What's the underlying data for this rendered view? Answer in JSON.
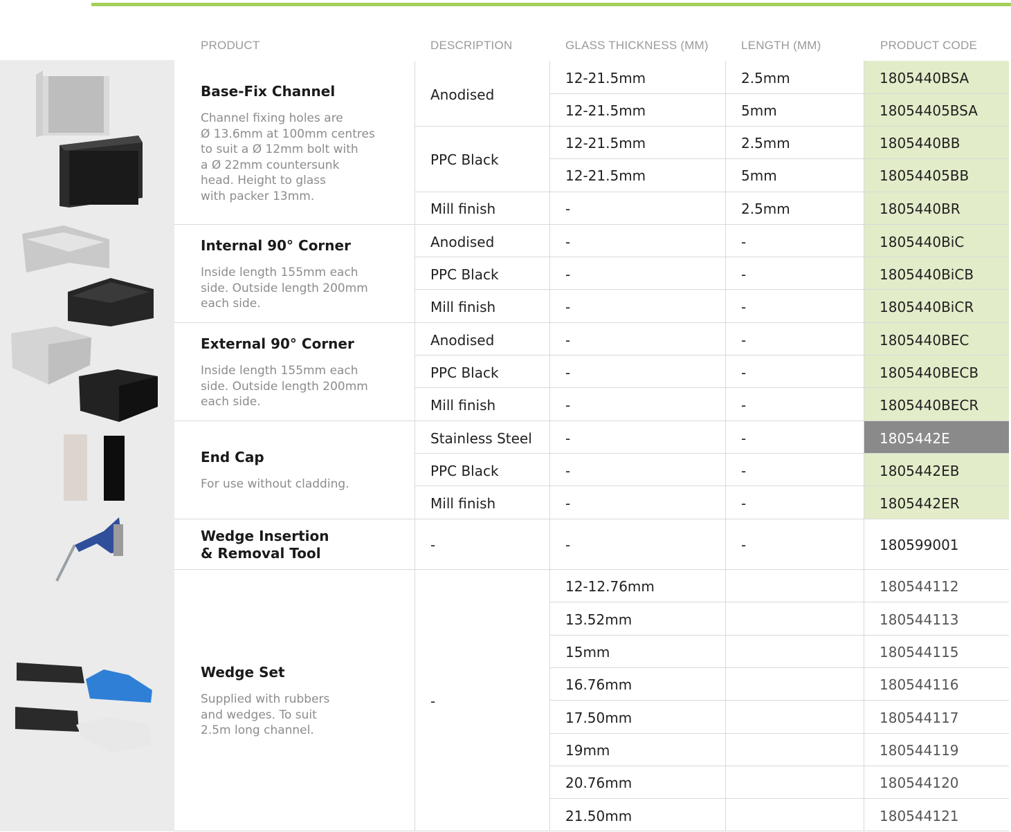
{
  "headers": {
    "product": "PRODUCT",
    "description": "DESCRIPTION",
    "glass": "GLASS THICKNESS (MM)",
    "length": "LENGTH (MM)",
    "code": "PRODUCT CODE"
  },
  "products": {
    "base": {
      "name": "Base-Fix Channel",
      "note": [
        "Channel fixing holes are",
        "Ø 13.6mm at 100mm centres",
        "to suit a Ø 12mm bolt with",
        "a Ø 22mm countersunk",
        "head. Height to glass",
        "with packer 13mm."
      ]
    },
    "internal": {
      "name": "Internal 90° Corner",
      "note": [
        "Inside length 155mm each",
        "side. Outside length 200mm",
        "each side."
      ]
    },
    "external": {
      "name": "External 90° Corner",
      "note": [
        "Inside length 155mm each",
        "side. Outside length 200mm",
        "each side."
      ]
    },
    "endcap": {
      "name": "End Cap",
      "note": [
        "For use without cladding."
      ]
    },
    "tool": {
      "name": [
        "Wedge Insertion",
        "& Removal Tool"
      ]
    },
    "wedge": {
      "name": "Wedge Set",
      "note": [
        "Supplied with rubbers",
        "and wedges. To suit",
        "2.5m long channel."
      ]
    }
  },
  "descriptions": {
    "base_anodised": "Anodised",
    "base_ppc": "PPC Black",
    "base_mill": "Mill finish",
    "int_anodised": "Anodised",
    "int_ppc": "PPC Black",
    "int_mill": "Mill finish",
    "ext_anodised": "Anodised",
    "ext_ppc": "PPC Black",
    "ext_mill": "Mill finish",
    "end_ss": "Stainless Steel",
    "end_ppc": "PPC Black",
    "end_mill": "Mill finish",
    "tool": "-",
    "wedge": "-"
  },
  "rows": [
    {
      "glass": "12-21.5mm",
      "length": "2.5mm",
      "code": "1805440BSA"
    },
    {
      "glass": "12-21.5mm",
      "length": "5mm",
      "code": "18054405BSA"
    },
    {
      "glass": "12-21.5mm",
      "length": "2.5mm",
      "code": "1805440BB"
    },
    {
      "glass": "12-21.5mm",
      "length": "5mm",
      "code": "18054405BB"
    },
    {
      "glass": "-",
      "length": "2.5mm",
      "code": "1805440BR"
    },
    {
      "glass": "-",
      "length": "-",
      "code": "1805440BiC"
    },
    {
      "glass": "-",
      "length": "-",
      "code": "1805440BiCB"
    },
    {
      "glass": "-",
      "length": "-",
      "code": "1805440BiCR"
    },
    {
      "glass": "-",
      "length": "-",
      "code": "1805440BEC"
    },
    {
      "glass": "-",
      "length": "-",
      "code": "1805440BECB"
    },
    {
      "glass": "-",
      "length": "-",
      "code": "1805440BECR"
    },
    {
      "glass": "-",
      "length": "-",
      "code": "1805442E"
    },
    {
      "glass": "-",
      "length": "-",
      "code": "1805442EB"
    },
    {
      "glass": "-",
      "length": "-",
      "code": "1805442ER"
    }
  ],
  "tool_row": {
    "glass": "-",
    "length": "-",
    "code": "180599001"
  },
  "wedge_rows": [
    {
      "glass": "12-12.76mm",
      "code": "180544112"
    },
    {
      "glass": "13.52mm",
      "code": "180544113"
    },
    {
      "glass": "15mm",
      "code": "180544115"
    },
    {
      "glass": "16.76mm",
      "code": "180544116"
    },
    {
      "glass": "17.50mm",
      "code": "180544117"
    },
    {
      "glass": "19mm",
      "code": "180544119"
    },
    {
      "glass": "20.76mm",
      "code": "180544120"
    },
    {
      "glass": "21.50mm",
      "code": "180544121"
    }
  ],
  "colors": {
    "accent": "#a3cf5a",
    "code_bg": "#e2ecc9",
    "code_bg_highlight": "#8a8a8a",
    "left_panel": "#ebebeb"
  }
}
